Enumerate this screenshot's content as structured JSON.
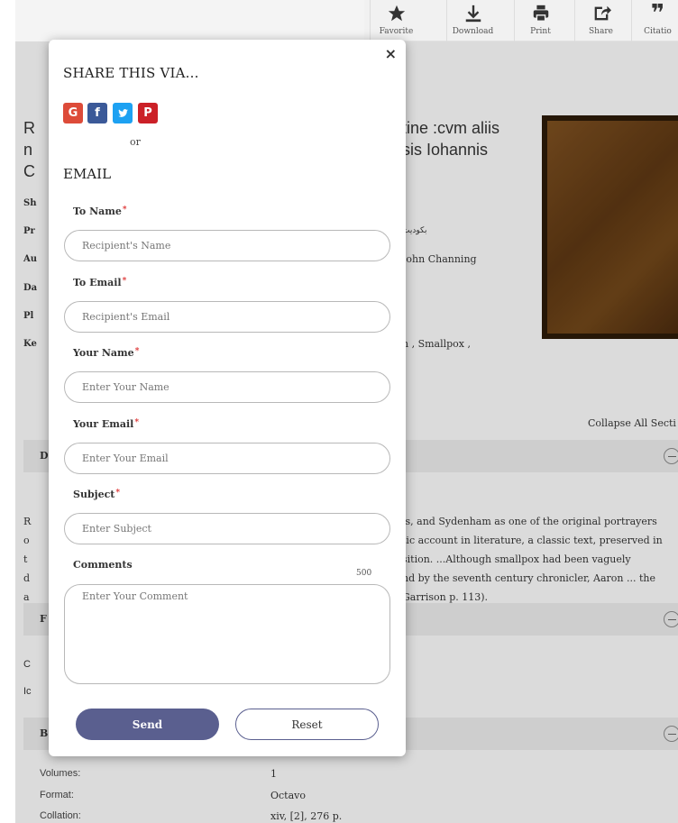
{
  "toolbar": {
    "items": [
      {
        "label": "Favorite",
        "icon": "star-icon"
      },
      {
        "label": "Download",
        "icon": "download-icon"
      },
      {
        "label": "Print",
        "icon": "print-icon"
      },
      {
        "label": "Share",
        "icon": "share-icon"
      },
      {
        "label": "Citatio",
        "icon": "quote-icon"
      }
    ]
  },
  "background": {
    "title_line1_left": "R",
    "title_line1_right": "tine :cvm aliis",
    "title_line2_left": "n",
    "title_line2_right": "sis Iohannis",
    "title_line3_left": "C",
    "label_short": "Sh",
    "label_pr": "Pr",
    "label_au": "Au",
    "label_da": "Da",
    "label_pl": "Pl",
    "label_ke": "Ke",
    "val_arabic": "بكوديت",
    "val_author": "John Channing",
    "val_keywords": "n , Smallpox ,",
    "collapse_all": "Collapse All Secti",
    "sec1_letter": "D",
    "sec2_letter": "F",
    "sec3_letter": "B",
    "para_left": [
      "R",
      "o",
      "t",
      "d",
      "a"
    ],
    "para_right": [
      "is, and Sydenham as one of the original portrayers",
      "tic account in literature, a classic text, preserved in",
      "sition. ...Although smallpox had been vaguely",
      "nd by the seventh century chronicler, Aaron ... the",
      "Garrison p. 113)."
    ],
    "sec2_lines": [
      "C",
      "Ic"
    ],
    "details": [
      {
        "label": "Volumes:",
        "value": "1"
      },
      {
        "label": "Format:",
        "value": "Octavo"
      },
      {
        "label": "Collation:",
        "value": "xiv, [2], 276 p."
      }
    ]
  },
  "modal": {
    "close": "×",
    "share_title": "SHARE THIS VIA...",
    "or": "or",
    "email_title": "EMAIL",
    "fields": {
      "to_name": {
        "label": "To Name",
        "placeholder": "Recipient's Name"
      },
      "to_email": {
        "label": "To Email",
        "placeholder": "Recipient's Email"
      },
      "your_name": {
        "label": "Your Name",
        "placeholder": "Enter Your Name"
      },
      "your_email": {
        "label": "Your Email",
        "placeholder": "Enter Your Email"
      },
      "subject": {
        "label": "Subject",
        "placeholder": "Enter Subject"
      },
      "comments": {
        "label": "Comments",
        "placeholder": "Enter Your Comment",
        "counter": "500"
      }
    },
    "required_mark": "*",
    "send_label": "Send",
    "reset_label": "Reset",
    "colors": {
      "send": "#5a5f8f",
      "google": "#dd4b39",
      "facebook": "#3b5998",
      "twitter": "#1da1f2",
      "pinterest": "#cb2027"
    }
  }
}
